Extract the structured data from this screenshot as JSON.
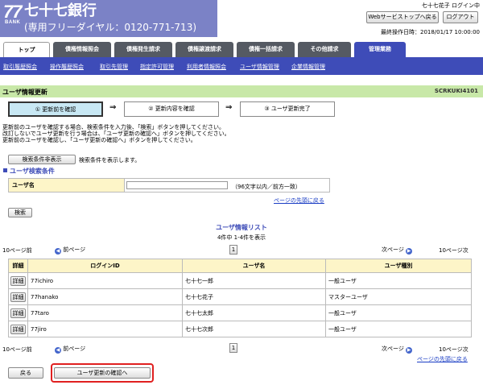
{
  "header": {
    "logo_number": "77",
    "logo_word": "BANK",
    "bank_name": "七十七銀行",
    "dial": "(専用フリーダイヤル：0120-771-713)",
    "user_info": "七十七花子 ログイン中",
    "web_service_button": "Webサービストップへ戻る",
    "logout_button": "ログアウト",
    "last_operation": "最終操作日時：2018/01/17 10:00:00"
  },
  "tabs": [
    "トップ",
    "債権情報照会",
    "債権発生請求",
    "債権譲渡請求",
    "債権一括請求",
    "その他請求",
    "管理業務"
  ],
  "subnav": [
    "取引履歴照会",
    "操作履歴照会",
    "取引先管理",
    "指定許可管理",
    "利用者情報照会",
    "ユーザ情報管理",
    "企業情報管理"
  ],
  "page": {
    "title": "ユーザ情報更新",
    "screen_id": "SCRKUKI4101"
  },
  "steps": [
    "① 更新前を確認",
    "② 更新内容を確認",
    "③ ユーザ更新完了"
  ],
  "arrow": "⇒",
  "instructions": [
    "更新前のユーザを確認する場合、検索条件を入力後、「検索」ボタンを押してください。",
    "改訂しないでユーザ更新を行う場合は、「ユーザ更新の確認へ」ボタンを押してください。",
    "更新前のユーザを確認し、「ユーザ更新の確認へ」ボタンを押してください。"
  ],
  "search_toggle": {
    "button": "検索条件非表示",
    "note": "検索条件を表示します。"
  },
  "search_section": {
    "title": "ユーザ検索条件",
    "field_label": "ユーザ名",
    "field_value": "",
    "hint": "（96文字以内／前方一致）",
    "top_link": "ページの先頭に戻る",
    "search_button": "検索"
  },
  "list": {
    "title": "ユーザ情報リスト",
    "count": "4件中 1-4件を表示",
    "prev10": "10ページ前",
    "prev": "前ページ",
    "page": "1",
    "next": "次ページ",
    "next10": "10ページ次",
    "columns": [
      "詳細",
      "ログインID",
      "ユーザ名",
      "ユーザ種別"
    ],
    "detail_button": "詳細",
    "rows": [
      {
        "login_id": "77ichiro",
        "name": "七十七一郎",
        "type": "一般ユーザ"
      },
      {
        "login_id": "77hanako",
        "name": "七十七花子",
        "type": "マスターユーザ"
      },
      {
        "login_id": "77taro",
        "name": "七十七太郎",
        "type": "一般ユーザ"
      },
      {
        "login_id": "77jiro",
        "name": "七十七次郎",
        "type": "一般ユーザ"
      }
    ],
    "top_link": "ページの先頭に戻る"
  },
  "footer": {
    "back_button": "戻る",
    "confirm_button": "ユーザ更新の確認へ"
  },
  "colors": {
    "brand": "#7b82c6",
    "nav": "#3e4cb8",
    "title_bar": "#c8e8a8",
    "highlight": "#e02020"
  }
}
